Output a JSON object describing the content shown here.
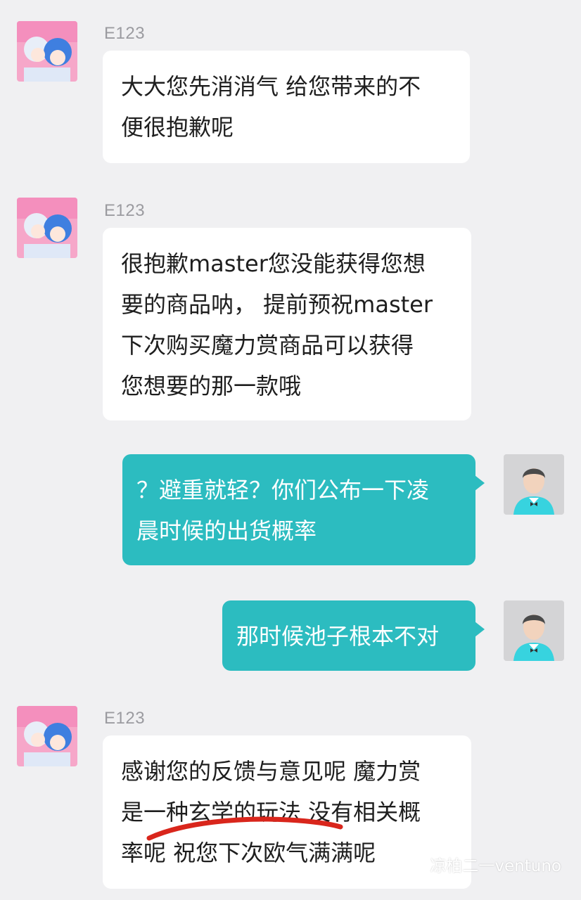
{
  "messages": [
    {
      "sender": "E123",
      "direction": "incoming",
      "lines": [
        "大大您先消消气 给您带来的不",
        "便很抱歉呢"
      ]
    },
    {
      "sender": "E123",
      "direction": "incoming",
      "lines": [
        "很抱歉master您没能获得您想",
        "要的商品呐， 提前预祝master",
        "下次购买魔力赏商品可以获得",
        "您想要的那一款哦"
      ]
    },
    {
      "sender": "",
      "direction": "outgoing",
      "lines": [
        "？避重就轻？你们公布一下凌",
        "晨时候的出货概率"
      ]
    },
    {
      "sender": "",
      "direction": "outgoing",
      "lines": [
        "那时候池子根本不对"
      ]
    },
    {
      "sender": "E123",
      "direction": "incoming",
      "lines": [
        "感谢您的反馈与意见呢 魔力赏",
        "是一种玄学的玩法 没有相关概",
        "率呢 祝您下次欧气满满呢"
      ]
    }
  ],
  "annotation": {
    "underlined_text": "一种玄学的玩法",
    "color": "#d9261c"
  },
  "watermark": {
    "icon": "wechat-icon",
    "text": "凉柏二一ventuno"
  },
  "colors": {
    "background": "#f0f0f2",
    "outgoing_bubble": "#2cbcc0",
    "incoming_bubble": "#ffffff",
    "sender_name": "#9b9ba0"
  }
}
